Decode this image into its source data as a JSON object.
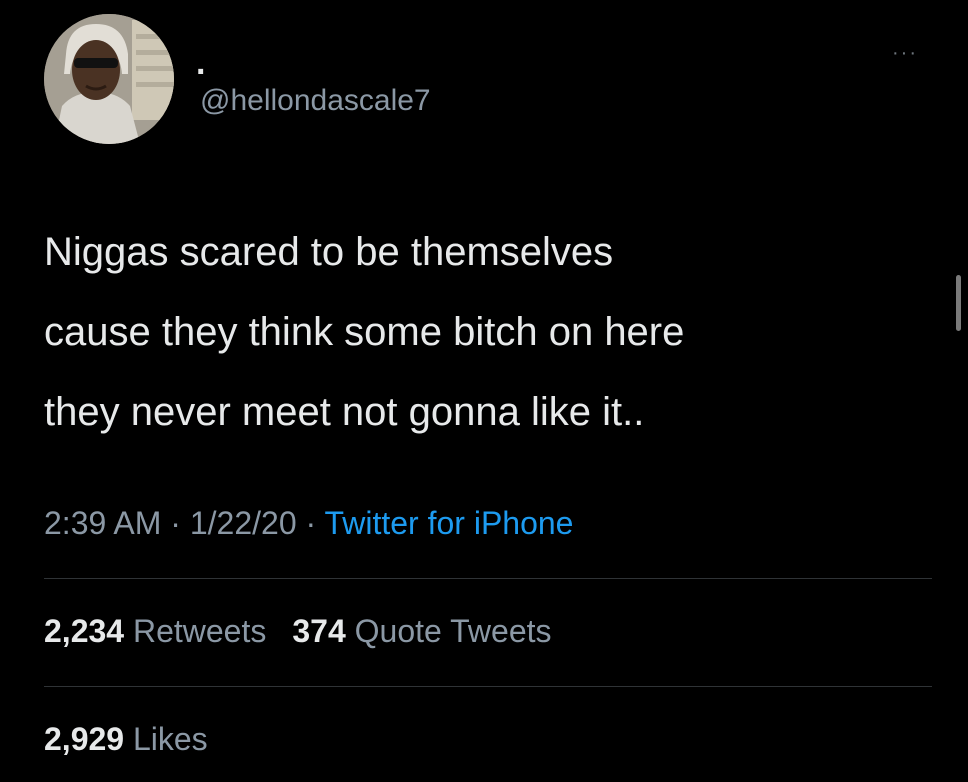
{
  "tweet": {
    "author": {
      "display_name": ".",
      "handle": "@hellondascale7",
      "avatar": "avatar-photo"
    },
    "more_icon": "more-horizontal-icon",
    "more_label": "···",
    "text": "Niggas scared to be themselves\ncause they think some bitch on here\nthey never meet not gonna like it..",
    "time": "2:39 AM",
    "sep1": " · ",
    "date": "1/22/20",
    "sep2": " · ",
    "source": "Twitter for iPhone",
    "retweets": {
      "count": "2,234",
      "label": "Retweets"
    },
    "quote_tweets": {
      "count": "374",
      "label": "Quote Tweets"
    },
    "likes": {
      "count": "2,929",
      "label": "Likes"
    }
  },
  "colors": {
    "background": "#000000",
    "text_primary": "#e7e9ea",
    "text_secondary": "#8b98a5",
    "link": "#1d9bf0",
    "divider": "#2f3336"
  }
}
